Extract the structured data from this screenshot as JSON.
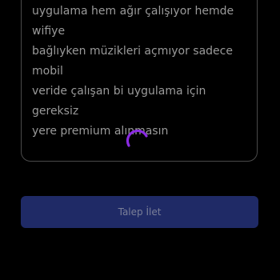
{
  "form": {
    "message_text": "uygulama hem ağır çalışıyor hemde wifiye\nbağlıyken müzikleri açmıyor sadece mobil\nveride çalışan bi uygulama için gereksiz\nyere premium alınmasın",
    "submit_label": "Talep İlet",
    "loading_icon": "loading-spinner-icon"
  },
  "colors": {
    "background": "#000000",
    "text": "#9a9a9a",
    "border": "#4a4a4a",
    "spinner": "#8a2be2",
    "button_bg": "#1f2a66",
    "button_text": "#7a7f98"
  }
}
